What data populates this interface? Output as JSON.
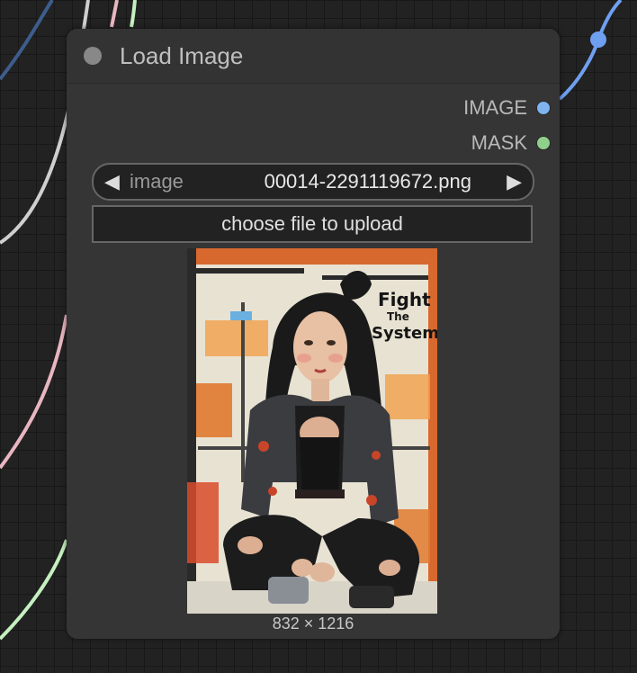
{
  "node": {
    "title": "Load Image",
    "outputs": [
      {
        "label": "IMAGE",
        "color": "#7fb4f0"
      },
      {
        "label": "MASK",
        "color": "#8fd18a"
      }
    ],
    "widget": {
      "label": "image",
      "value": "00014-2291119672.png",
      "prev_arrow": "◀",
      "next_arrow": "▶"
    },
    "upload_button": "choose file to upload",
    "preview": {
      "poster_text_line1": "Fight",
      "poster_text_line2": "The",
      "poster_text_line3": "System!"
    },
    "dimensions": "832 × 1216"
  },
  "colors": {
    "link_blue": "#6f9ff0",
    "link_dark_blue": "#3d5d8c",
    "link_white": "#cfcfcf",
    "link_pink": "#e8b6c0",
    "link_green": "#c5f0c0"
  }
}
